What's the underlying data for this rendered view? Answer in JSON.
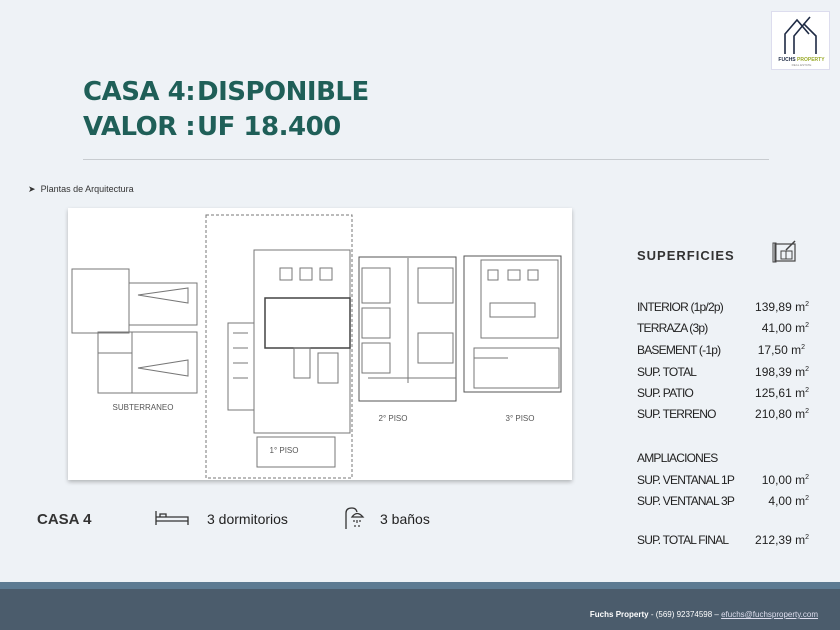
{
  "logo": {
    "brand": "FUCHS PROPERTY",
    "tagline": "REAL ESTATE",
    "colors": {
      "house": "#1e2a44",
      "accent": "#9aaa2a"
    }
  },
  "header": {
    "line1_key": "CASA 4:",
    "line1_value": "DISPONIBLE",
    "line2_key": "VALOR :",
    "line2_value": "UF 18.400"
  },
  "section_bullet": "Plantas de Arquitectura",
  "plan": {
    "labels": [
      "SUBTERRANEO",
      "1° PISO",
      "2° PISO",
      "3° PISO"
    ]
  },
  "superficies": {
    "title": "SUPERFICIES",
    "icon": "blueprint-icon",
    "unit": "m",
    "unit_exp": "2",
    "rows": [
      {
        "label": "INTERIOR (1p/2p)",
        "value": "139,89"
      },
      {
        "label": "TERRAZA (3p)",
        "value": "41,00"
      },
      {
        "label": "BASEMENT (-1p)",
        "value": "17,50"
      },
      {
        "label": "SUP. TOTAL",
        "value": "198,39"
      },
      {
        "label": "SUP.  PATIO",
        "value": "125,61"
      },
      {
        "label": "SUP.  TERRENO",
        "value": "210,80"
      }
    ],
    "ampliaciones_title": "AMPLIACIONES",
    "ampliaciones": [
      {
        "label": "SUP.  VENTANAL 1P",
        "value": "10,00"
      },
      {
        "label": "SUP.  VENTANAL 3P",
        "value": "4,00"
      }
    ],
    "total": {
      "label": "SUP. TOTAL FINAL",
      "value": "212,39"
    }
  },
  "casa": {
    "name": "CASA 4",
    "bedrooms": "3 dormitorios",
    "bathrooms": "3 baños"
  },
  "footer": {
    "company": "Fuchs Property",
    "sep": " -  (569) 92374598 – ",
    "email": "efuchs@fuchsproperty.com"
  }
}
